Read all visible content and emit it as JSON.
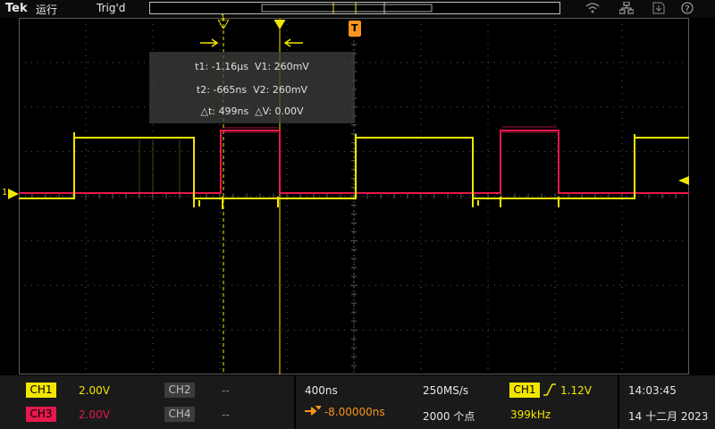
{
  "topbar": {
    "brand": "Tek",
    "run_state": "运行",
    "trigger_state": "Trig'd",
    "icons": [
      "wifi-icon",
      "network-icon",
      "save-icon",
      "help-icon"
    ]
  },
  "cursors": {
    "t1_label": "t1: -1.16µs",
    "v1_label": "V1: 260mV",
    "t2_label": "t2: -665ns",
    "v2_label": "V2: 260mV",
    "dt_label": "△t: 499ns",
    "dv_label": "△V: 0.00V",
    "marker1": "1",
    "marker2": "2"
  },
  "markers": {
    "trigger_position": "T",
    "ch1_ground": "1"
  },
  "channels": {
    "ch1": {
      "name": "CH1",
      "scale": "2.00V",
      "color": "#f2e600"
    },
    "ch2": {
      "name": "CH2",
      "scale": "--"
    },
    "ch3": {
      "name": "CH3",
      "scale": "2.00V",
      "color": "#e5194c"
    },
    "ch4": {
      "name": "CH4",
      "scale": "--"
    }
  },
  "timebase": {
    "scale": "400ns",
    "sample_rate": "250MS/s",
    "position": "-8.00000ns",
    "record_length": "2000 个点"
  },
  "trigger": {
    "source": "CH1",
    "slope_icon": "rising-edge-icon",
    "level": "1.12V",
    "frequency": "399kHz"
  },
  "clock": {
    "time": "14:03:45",
    "date": "14 十二月 2023"
  },
  "colors": {
    "ch1": "#f2e600",
    "ch3": "#e5194c",
    "trigger": "#f7941d",
    "grid": "#5a5a5a"
  }
}
